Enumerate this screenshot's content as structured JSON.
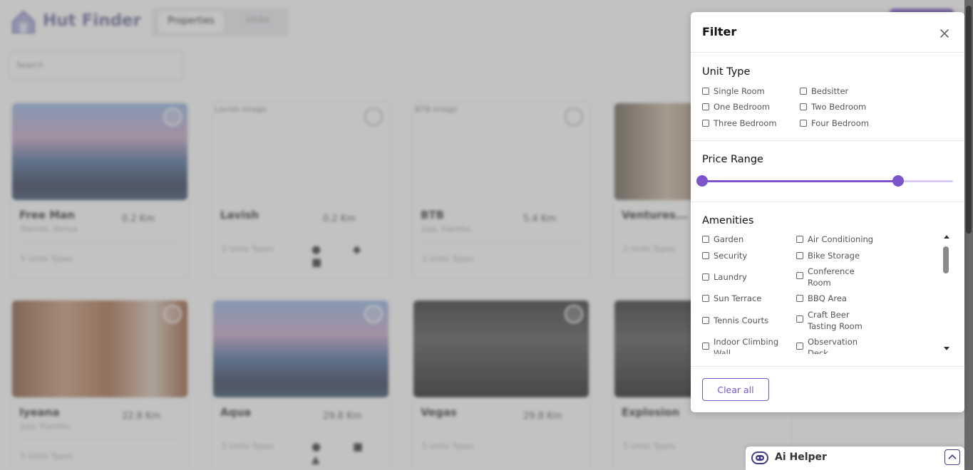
{
  "app": {
    "brand": "Hut Finder"
  },
  "header": {
    "tabs": [
      "Properties",
      "Units"
    ]
  },
  "search": {
    "placeholder": "Search"
  },
  "cards": [
    {
      "title": "Free Man",
      "distance": "0.2 Km",
      "location": "Nairobi, Kenya",
      "units": "5 Units Types",
      "image": "house"
    },
    {
      "title": "Lavish",
      "distance": "0.2 Km",
      "units": "2 Units Types",
      "image_alt": "Lavish image"
    },
    {
      "title": "BTB",
      "distance": "5.4 Km",
      "location": "Juja, Kiambu",
      "units": "2 Units Types",
      "image_alt": "BTB image"
    },
    {
      "title": "Ventures...",
      "units": "2 Units Types",
      "image": "tower"
    },
    {
      "title": "Iyeana",
      "distance": "22.8 Km",
      "location": "Juja, Kiambu",
      "units": "5 Units Types",
      "image": "room"
    },
    {
      "title": "Aqua",
      "distance": "29.8 Km",
      "units": "5 Units Types",
      "image": "house"
    },
    {
      "title": "Vegas",
      "distance": "29.8 Km",
      "units": "5 Units Types",
      "image": "dark"
    },
    {
      "title": "Explosion",
      "units": "5 Units Types",
      "image": "dark"
    }
  ],
  "filter": {
    "title": "Filter",
    "unit_type": {
      "title": "Unit Type",
      "options": [
        "Single Room",
        "Bedsitter",
        "One Bedroom",
        "Two Bedroom",
        "Three Bedroom",
        "Four Bedroom"
      ]
    },
    "price_range": {
      "title": "Price Range",
      "min_fraction": 0,
      "max_fraction": 0.78
    },
    "amenities": {
      "title": "Amenities",
      "options": [
        "Garden",
        "Air Conditioning",
        "Security",
        "Bike Storage",
        "Laundry",
        "Conference Room",
        "Sun Terrace",
        "BBQ Area",
        "Tennis Courts",
        "Craft Beer Tasting Room",
        "Indoor Climbing Wall",
        "Observation Deck"
      ]
    },
    "clear_label": "Clear all"
  },
  "ai_helper": {
    "label": "Ai Helper"
  },
  "colors": {
    "accent": "#7b55c9",
    "accent_light": "#d9ccf2"
  }
}
